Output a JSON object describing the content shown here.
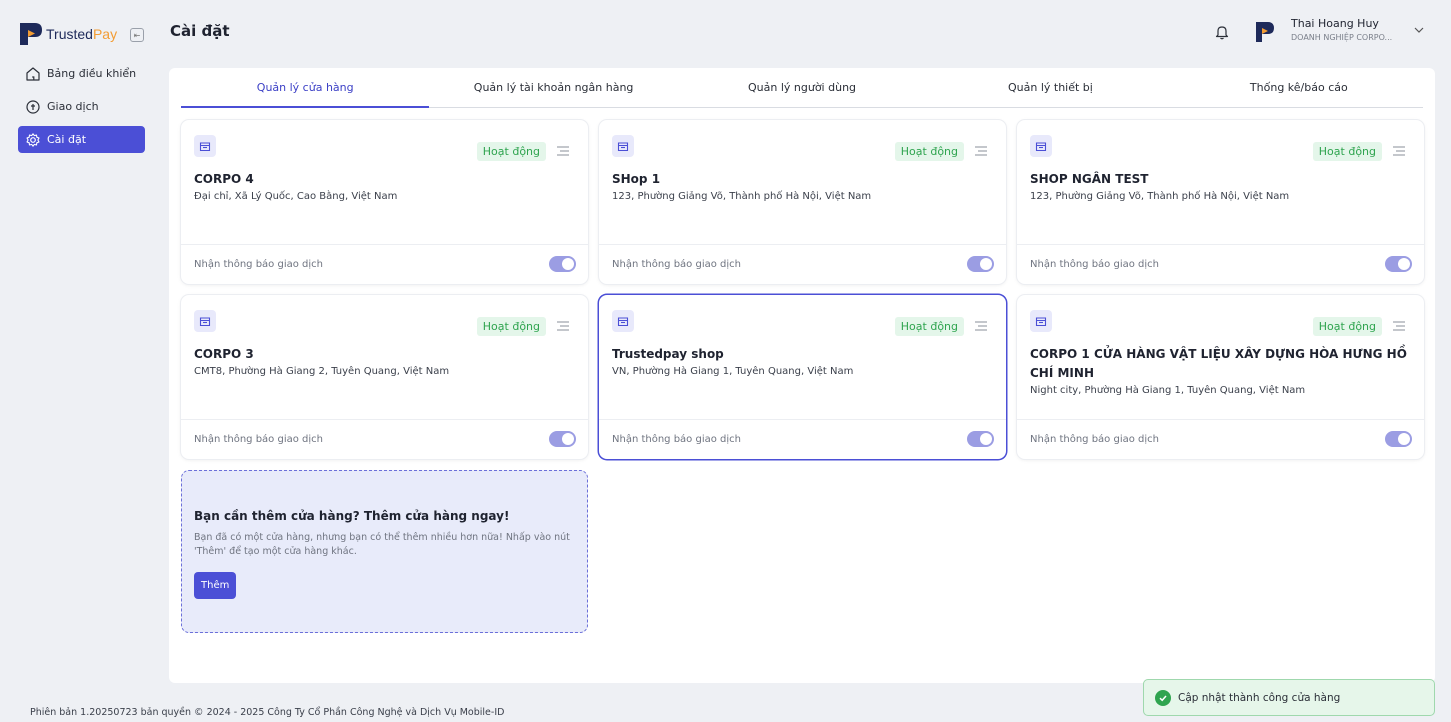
{
  "app": {
    "logo_trusted": "Trusted",
    "logo_pay": "Pay"
  },
  "sidebar": {
    "items": [
      {
        "label": "Bảng điều khiển",
        "icon": "home-icon"
      },
      {
        "label": "Giao dịch",
        "icon": "transaction-icon"
      },
      {
        "label": "Cài đặt",
        "icon": "gear-icon"
      }
    ]
  },
  "header": {
    "title": "Cài đặt",
    "user_name": "Thai Hoang Huy",
    "user_org": "DOANH NGHIỆP CORPO..."
  },
  "tabs": [
    {
      "label": "Quản lý cửa hàng"
    },
    {
      "label": "Quản lý tài khoản ngân hàng"
    },
    {
      "label": "Quản lý người dùng"
    },
    {
      "label": "Quản lý thiết bị"
    },
    {
      "label": "Thống kê/báo cáo"
    }
  ],
  "stores": [
    {
      "name": "CORPO 4",
      "address": "Đại chỉ, Xã Lý Quốc, Cao Bằng, Việt Nam",
      "status": "Hoạt động",
      "notify_label": "Nhận thông báo giao dịch",
      "notify_on": true
    },
    {
      "name": "SHop 1",
      "address": "123, Phường Giảng Võ, Thành phố Hà Nội, Việt Nam",
      "status": "Hoạt động",
      "notify_label": "Nhận thông báo giao dịch",
      "notify_on": true
    },
    {
      "name": "SHOP NGÂN TEST",
      "address": "123, Phường Giảng Võ, Thành phố Hà Nội, Việt Nam",
      "status": "Hoạt động",
      "notify_label": "Nhận thông báo giao dịch",
      "notify_on": true
    },
    {
      "name": "CORPO 3",
      "address": "CMT8, Phường Hà Giang 2, Tuyên Quang, Việt Nam",
      "status": "Hoạt động",
      "notify_label": "Nhận thông báo giao dịch",
      "notify_on": true
    },
    {
      "name": "Trustedpay shop",
      "address": "VN, Phường Hà Giang 1, Tuyên Quang, Việt Nam",
      "status": "Hoạt động",
      "notify_label": "Nhận thông báo giao dịch",
      "notify_on": true
    },
    {
      "name": "CORPO 1 CỬA HÀNG VẬT LIỆU XÂY DỰNG HÒA HƯNG HỒ CHÍ MINH",
      "address": "Night city, Phường Hà Giang 1, Tuyên Quang, Việt Nam",
      "status": "Hoạt động",
      "notify_label": "Nhận thông báo giao dịch",
      "notify_on": true
    }
  ],
  "add_store": {
    "title": "Bạn cần thêm cửa hàng? Thêm cửa hàng ngay!",
    "description": "Bạn đã có một cửa hàng, nhưng bạn có thể thêm nhiều hơn nữa! Nhấp vào nút 'Thêm' để tạo một cửa hàng khác.",
    "button_label": "Thêm"
  },
  "footer": {
    "text": "Phiên bản 1.20250723 bản quyền © 2024 - 2025 Công Ty Cổ Phần Công Nghệ và Dịch Vụ Mobile-ID"
  },
  "toast": {
    "message": "Cập nhật thành công cửa hàng"
  },
  "colors": {
    "accent": "#4b4fd6",
    "status_green": "#2fa44f",
    "logo_orange": "#f39c33"
  }
}
